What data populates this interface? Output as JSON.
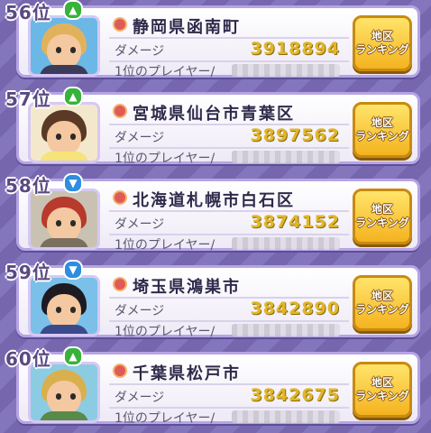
{
  "labels": {
    "damage": "ダメージ",
    "top_player": "1位のプレイヤー/",
    "button_line1": "地区",
    "button_line2": "ランキング"
  },
  "entries": [
    {
      "rank": "56位",
      "trend": "up",
      "region": "静岡県函南町",
      "damage": "3918894",
      "avatar": {
        "hair": "#e1b25c",
        "bg": "#6bb8e6",
        "shirt": "#3c3c5a"
      }
    },
    {
      "rank": "57位",
      "trend": "up",
      "region": "宮城県仙台市青葉区",
      "damage": "3897562",
      "avatar": {
        "hair": "#5a3a26",
        "bg": "#f4e8cc",
        "shirt": "#f6e37a"
      }
    },
    {
      "rank": "58位",
      "trend": "down",
      "region": "北海道札幌市白石区",
      "damage": "3874152",
      "avatar": {
        "hair": "#b83a2c",
        "bg": "#c9c2b2",
        "shirt": "#7a7060"
      }
    },
    {
      "rank": "59位",
      "trend": "down",
      "region": "埼玉県鴻巣市",
      "damage": "3842890",
      "avatar": {
        "hair": "#1e1a22",
        "bg": "#7ac0e8",
        "shirt": "#3a4a8a"
      }
    },
    {
      "rank": "60位",
      "trend": "up",
      "region": "千葉県松戸市",
      "damage": "3842675",
      "avatar": {
        "hair": "#d9b04e",
        "bg": "#8ccce2",
        "shirt": "#5a8a4a"
      }
    }
  ],
  "icons": {
    "up": "arrow-up-icon",
    "down": "arrow-down-icon",
    "medal": "medal-icon"
  }
}
